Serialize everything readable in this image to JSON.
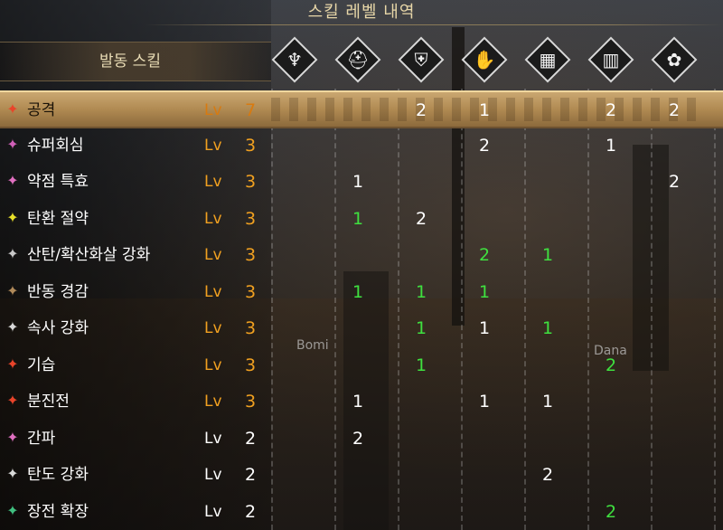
{
  "title": "스킬 레벨 내역",
  "active_skills_label": "발동 스킬",
  "level_prefix": "Lv",
  "equipment_slots": [
    {
      "icon": "weapon-icon",
      "glyph": "♆"
    },
    {
      "icon": "helm-icon",
      "glyph": "⛑"
    },
    {
      "icon": "chest-armor-icon",
      "glyph": "⛨"
    },
    {
      "icon": "arm-armor-icon",
      "glyph": "✋"
    },
    {
      "icon": "waist-armor-icon",
      "glyph": "▦"
    },
    {
      "icon": "leg-armor-icon",
      "glyph": "▥"
    },
    {
      "icon": "talisman-icon",
      "glyph": "✿"
    }
  ],
  "skills": [
    {
      "name": "공격",
      "level": "7",
      "color": "#e8442a",
      "maxed": true,
      "highlighted": true,
      "cells": [
        "",
        "",
        "2",
        "1",
        "",
        "2",
        "2"
      ],
      "cell_colors": [
        "w",
        "w",
        "w",
        "w",
        "w",
        "w",
        "w"
      ]
    },
    {
      "name": "슈퍼회심",
      "level": "3",
      "color": "#d060b8",
      "maxed": true,
      "cells": [
        "",
        "",
        "",
        "2",
        "",
        "1",
        ""
      ],
      "cell_colors": [
        "w",
        "w",
        "w",
        "w",
        "w",
        "w",
        "w"
      ]
    },
    {
      "name": "약점 특효",
      "level": "3",
      "color": "#e070c0",
      "maxed": true,
      "cells": [
        "",
        "1",
        "",
        "",
        "",
        "",
        "2"
      ],
      "cell_colors": [
        "w",
        "w",
        "w",
        "w",
        "w",
        "w",
        "w"
      ]
    },
    {
      "name": "탄환 절약",
      "level": "3",
      "color": "#e8e02a",
      "maxed": true,
      "cells": [
        "",
        "1",
        "2",
        "",
        "",
        "",
        ""
      ],
      "cell_colors": [
        "w",
        "g",
        "w",
        "w",
        "w",
        "w",
        "w"
      ]
    },
    {
      "name": "산탄/확산화살 강화",
      "level": "3",
      "color": "#c8c8c8",
      "maxed": true,
      "cells": [
        "",
        "",
        "",
        "2",
        "1",
        "",
        ""
      ],
      "cell_colors": [
        "w",
        "w",
        "w",
        "g",
        "g",
        "w",
        "w"
      ]
    },
    {
      "name": "반동 경감",
      "level": "3",
      "color": "#b08a5a",
      "maxed": true,
      "cells": [
        "",
        "1",
        "1",
        "1",
        "",
        "",
        ""
      ],
      "cell_colors": [
        "w",
        "g",
        "g",
        "g",
        "w",
        "w",
        "w"
      ]
    },
    {
      "name": "속사 강화",
      "level": "3",
      "color": "#d8d8d8",
      "maxed": true,
      "cells": [
        "",
        "",
        "1",
        "1",
        "1",
        "",
        ""
      ],
      "cell_colors": [
        "w",
        "w",
        "g",
        "w",
        "g",
        "w",
        "w"
      ]
    },
    {
      "name": "기습",
      "level": "3",
      "color": "#e8442a",
      "maxed": true,
      "cells": [
        "",
        "",
        "1",
        "",
        "",
        "2",
        ""
      ],
      "cell_colors": [
        "w",
        "w",
        "g",
        "w",
        "w",
        "g",
        "w"
      ]
    },
    {
      "name": "분진전",
      "level": "3",
      "color": "#e8442a",
      "maxed": true,
      "cells": [
        "",
        "1",
        "",
        "1",
        "1",
        "",
        ""
      ],
      "cell_colors": [
        "w",
        "w",
        "w",
        "w",
        "w",
        "w",
        "w"
      ]
    },
    {
      "name": "간파",
      "level": "2",
      "color": "#e070c0",
      "maxed": false,
      "cells": [
        "",
        "2",
        "",
        "",
        "",
        "",
        ""
      ],
      "cell_colors": [
        "w",
        "w",
        "w",
        "w",
        "w",
        "w",
        "w"
      ]
    },
    {
      "name": "탄도 강화",
      "level": "2",
      "color": "#d8d8d8",
      "maxed": false,
      "cells": [
        "",
        "",
        "",
        "",
        "2",
        "",
        ""
      ],
      "cell_colors": [
        "w",
        "w",
        "w",
        "w",
        "w",
        "w",
        "w"
      ]
    },
    {
      "name": "장전 확장",
      "level": "2",
      "color": "#40c080",
      "maxed": false,
      "cells": [
        "",
        "",
        "",
        "",
        "",
        "2",
        ""
      ],
      "cell_colors": [
        "w",
        "w",
        "w",
        "w",
        "w",
        "g",
        "w"
      ]
    }
  ],
  "player_tags": [
    {
      "label": "Bomi"
    },
    {
      "label": "Dana"
    }
  ]
}
